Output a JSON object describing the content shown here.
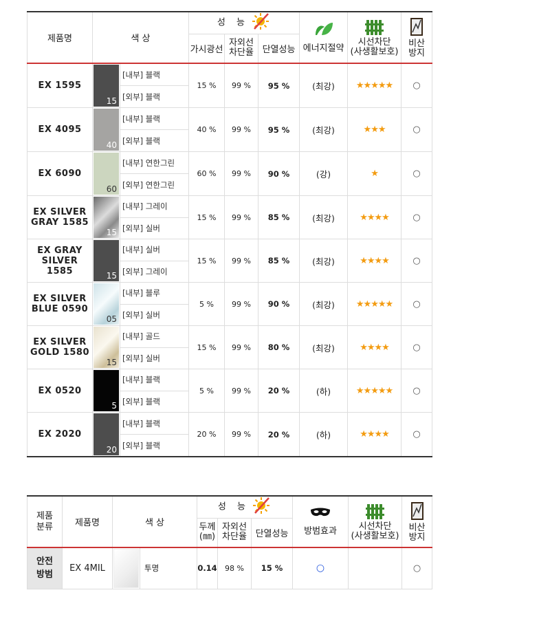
{
  "table1": {
    "headers": {
      "product_name": "제품명",
      "color": "색  상",
      "performance": "성 능",
      "visible_light": "가시광선",
      "uv_block": "자외선\n차단율",
      "insulation": "단열성능",
      "energy_saving": "에너지절약",
      "privacy": "시선차단\n(사생활보호)",
      "shatter": "비산\n방지"
    },
    "rows": [
      {
        "name": "EX  1595",
        "swatch_num": "15",
        "swatch_color": "#4d4d4d",
        "inner": "[내부] 블랙",
        "outer": "[외부] 블랙",
        "vlt": "15 %",
        "uv": "99  %",
        "ins": "95  %",
        "energy": "(최강)",
        "stars": "★★★★★",
        "shatter": "○"
      },
      {
        "name": "EX  4095",
        "swatch_num": "40",
        "swatch_color": "#a5a4a2",
        "inner": "[내부] 블랙",
        "outer": "[외부] 블랙",
        "vlt": "40 %",
        "uv": "99  %",
        "ins": "95  %",
        "energy": "(최강)",
        "stars": "★★★",
        "shatter": "○"
      },
      {
        "name": "EX  6090",
        "swatch_num": "60",
        "swatch_color": "#ccd6bf",
        "inner": "[내부] 연한그린",
        "outer": "[외부] 연한그린",
        "vlt": "60 %",
        "uv": "99  %",
        "ins": "90  %",
        "energy": "(강)",
        "stars": "★",
        "shatter": "○"
      },
      {
        "name": "EX SILVER\nGRAY 1585",
        "swatch_num": "15",
        "swatch_color": "silvergray",
        "inner": "[내부] 그레이",
        "outer": "[외부] 실버",
        "vlt": "15 %",
        "uv": "99  %",
        "ins": "85  %",
        "energy": "(최강)",
        "stars": "★★★★",
        "shatter": "○"
      },
      {
        "name": "EX GRAY\nSILVER 1585",
        "swatch_num": "15",
        "swatch_color": "#4d4d4d",
        "inner": "[내부] 실버",
        "outer": "[외부] 그레이",
        "vlt": "15 %",
        "uv": "99  %",
        "ins": "85  %",
        "energy": "(최강)",
        "stars": "★★★★",
        "shatter": "○"
      },
      {
        "name": "EX SILVER\nBLUE  0590",
        "swatch_num": "05",
        "swatch_color": "silverblue",
        "inner": "[내부] 블루",
        "outer": "[외부] 실버",
        "vlt": "5 %",
        "uv": "99  %",
        "ins": "90  %",
        "energy": "(최강)",
        "stars": "★★★★★",
        "shatter": "○"
      },
      {
        "name": "EX SILVER\nGOLD 1580",
        "swatch_num": "15",
        "swatch_color": "silvergold",
        "inner": "[내부] 골드",
        "outer": "[외부] 실버",
        "vlt": "15 %",
        "uv": "99  %",
        "ins": "80  %",
        "energy": "(최강)",
        "stars": "★★★★",
        "shatter": "○"
      },
      {
        "name": "EX  0520",
        "swatch_num": "5",
        "swatch_color": "#050505",
        "inner": "[내부] 블랙",
        "outer": "[외부] 블랙",
        "vlt": "5 %",
        "uv": "99  %",
        "ins": "20  %",
        "energy": "(하)",
        "stars": "★★★★★",
        "shatter": "○"
      },
      {
        "name": "EX  2020",
        "swatch_num": "20",
        "swatch_color": "#4d4d4d",
        "inner": "[내부] 블랙",
        "outer": "[외부] 블랙",
        "vlt": "20 %",
        "uv": "99  %",
        "ins": "20  %",
        "energy": "(하)",
        "stars": "★★★★",
        "shatter": "○"
      }
    ]
  },
  "table2": {
    "headers": {
      "category": "제품\n분류",
      "product_name": "제품명",
      "color": "색  상",
      "performance": "성 능",
      "thickness": "두께\n(㎜)",
      "uv_block": "자외선\n차단율",
      "insulation": "단열성능",
      "crime_prevention": "방범효과",
      "privacy": "시선차단\n(사생활보호)",
      "shatter": "비산\n방지"
    },
    "row": {
      "category": "안전\n방범",
      "name": "EX 4MIL",
      "color_label": "투명",
      "thickness": "0.14",
      "uv": "98  %",
      "ins": "15  %",
      "crime": "○",
      "privacy": "",
      "shatter": "○"
    }
  },
  "icons": [
    "sun-icon",
    "leaf-icon",
    "fence-icon",
    "window-icon",
    "mask-icon"
  ],
  "colors": {
    "accent_red": "#cc3333",
    "star": "#f39c12",
    "leaf": "#3aa53a",
    "fence": "#3c8c2c"
  }
}
